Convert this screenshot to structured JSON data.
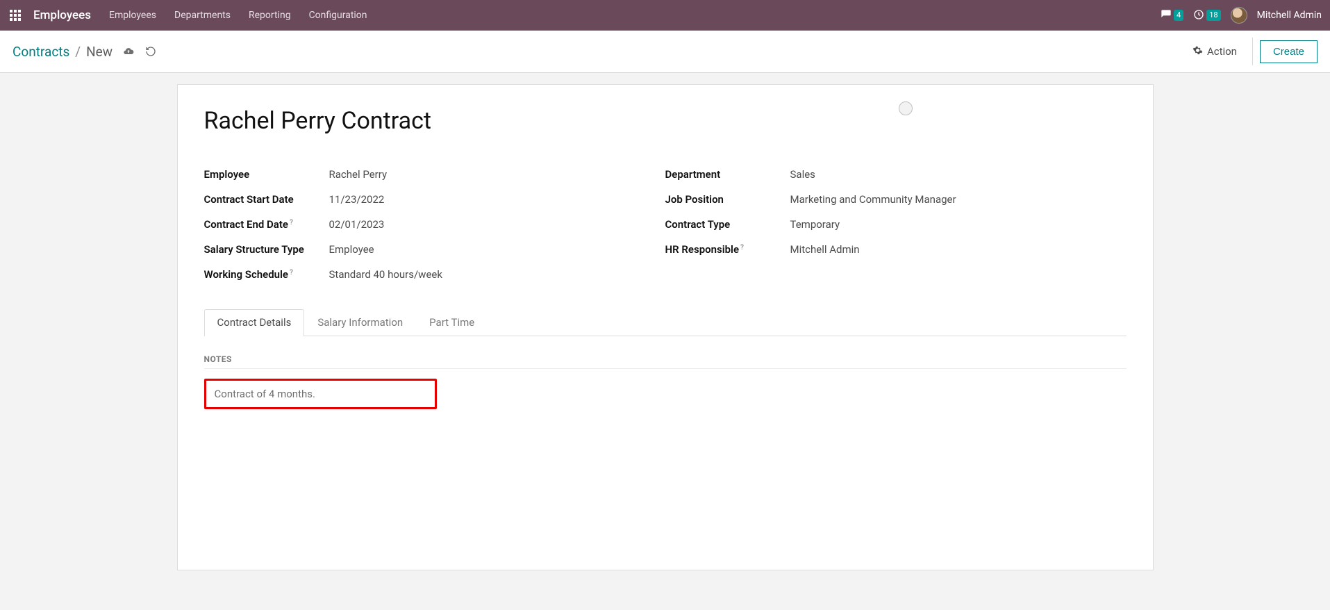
{
  "topbar": {
    "brand": "Employees",
    "menu": [
      "Employees",
      "Departments",
      "Reporting",
      "Configuration"
    ],
    "chat_count": "4",
    "clock_count": "18",
    "username": "Mitchell Admin"
  },
  "controlpanel": {
    "breadcrumb_root": "Contracts",
    "breadcrumb_current": "New",
    "action_label": "Action",
    "create_label": "Create"
  },
  "form": {
    "title": "Rachel Perry Contract",
    "left_fields": [
      {
        "label": "Employee",
        "value": "Rachel Perry",
        "help": false
      },
      {
        "label": "Contract Start Date",
        "value": "11/23/2022",
        "help": false
      },
      {
        "label": "Contract End Date",
        "value": "02/01/2023",
        "help": true
      },
      {
        "label": "Salary Structure Type",
        "value": "Employee",
        "help": false
      },
      {
        "label": "Working Schedule",
        "value": "Standard 40 hours/week",
        "help": true
      }
    ],
    "right_fields": [
      {
        "label": "Department",
        "value": "Sales",
        "help": false
      },
      {
        "label": "Job Position",
        "value": "Marketing and Community Manager",
        "help": false
      },
      {
        "label": "Contract Type",
        "value": "Temporary",
        "help": false
      },
      {
        "label": "HR Responsible",
        "value": "Mitchell Admin",
        "help": true
      }
    ],
    "tabs": [
      "Contract Details",
      "Salary Information",
      "Part Time"
    ],
    "active_tab": 0,
    "notes_title": "Notes",
    "notes_text": "Contract of 4 months."
  }
}
